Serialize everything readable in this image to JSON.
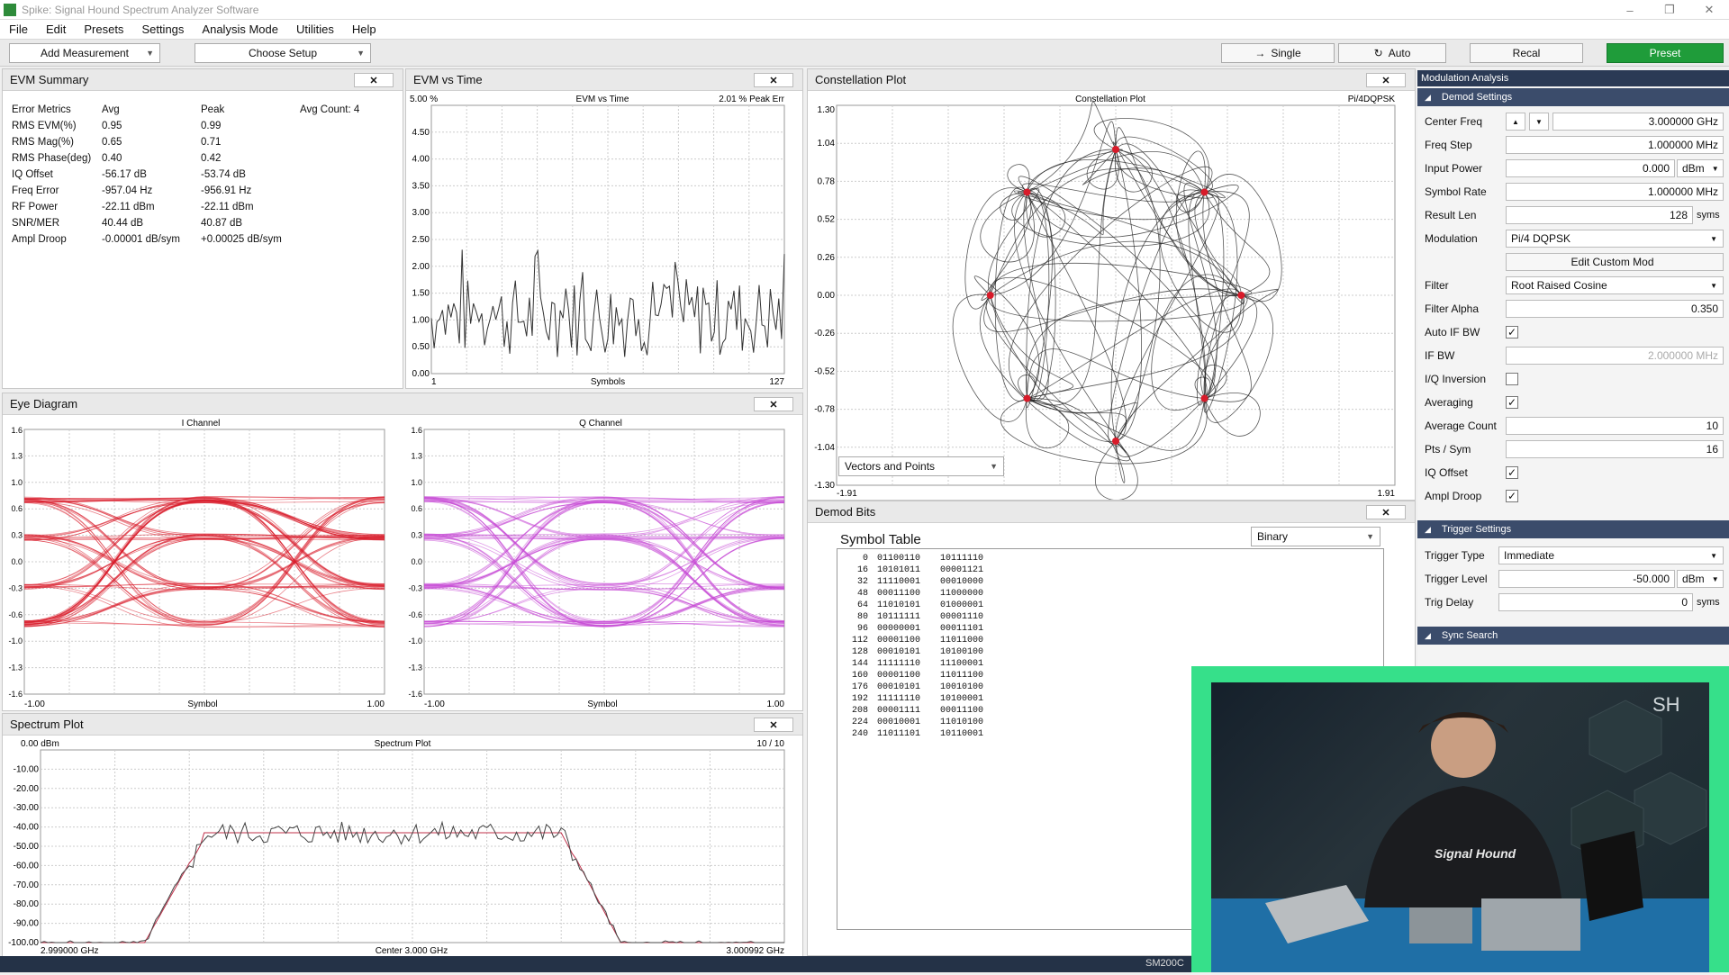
{
  "app": {
    "title": "Spike: Signal Hound Spectrum Analyzer Software"
  },
  "menu": [
    "File",
    "Edit",
    "Presets",
    "Settings",
    "Analysis Mode",
    "Utilities",
    "Help"
  ],
  "toolbar": {
    "add_measurement": "Add Measurement",
    "choose_setup": "Choose Setup",
    "single": "Single",
    "auto": "Auto",
    "recal": "Recal",
    "preset": "Preset"
  },
  "colors": {
    "accent": "#1f9c3a",
    "eye_i": "#d81b2a",
    "eye_q": "#c64ad6",
    "side_header": "#2b3a55",
    "trace": "#333333",
    "avg_trace": "#c0304a"
  },
  "evm_summary": {
    "title": "EVM Summary",
    "close": "✕",
    "headers": [
      "Error Metrics",
      "Avg",
      "Peak",
      "Avg Count: 4"
    ],
    "rows": [
      [
        "RMS EVM(%)",
        "0.95",
        "0.99"
      ],
      [
        "RMS Mag(%)",
        "0.65",
        "0.71"
      ],
      [
        "RMS Phase(deg)",
        "0.40",
        "0.42"
      ],
      [
        "IQ Offset",
        "-56.17 dB",
        "-53.74 dB"
      ],
      [
        "Freq Error",
        "-957.04 Hz",
        "-956.91 Hz"
      ],
      [
        "RF Power",
        "-22.11 dBm",
        "-22.11 dBm"
      ],
      [
        "SNR/MER",
        "40.44 dB",
        "40.87 dB"
      ],
      [
        "Ampl Droop",
        "-0.00001 dB/sym",
        "+0.00025 dB/sym"
      ]
    ]
  },
  "evm_time": {
    "title": "EVM vs Time",
    "close": "✕",
    "top_left": "5.00 %",
    "center": "EVM vs Time",
    "top_right": "2.01 % Peak Err",
    "yticks": [
      "4.50",
      "4.00",
      "3.50",
      "3.00",
      "2.50",
      "2.00",
      "1.50",
      "1.00",
      "0.50",
      "0.00"
    ],
    "x_start": "1",
    "x_label": "Symbols",
    "x_end": "127"
  },
  "constellation": {
    "title": "Constellation Plot",
    "close": "✕",
    "center": "Constellation Plot",
    "mod": "Pi/4DQPSK",
    "yticks": [
      "1.30",
      "1.04",
      "0.78",
      "0.52",
      "0.26",
      "0.00",
      "-0.26",
      "-0.52",
      "-0.78",
      "-1.04",
      "-1.30"
    ],
    "x_start": "-1.91",
    "x_end": "1.91",
    "view": "Vectors and Points"
  },
  "eye": {
    "title": "Eye Diagram",
    "close": "✕",
    "i_label": "I Channel",
    "q_label": "Q Channel",
    "yticks": [
      "1.6",
      "1.3",
      "1.0",
      "0.6",
      "0.3",
      "0.0",
      "-0.3",
      "-0.6",
      "-1.0",
      "-1.3",
      "-1.6"
    ],
    "x_start": "-1.00",
    "x_label": "Symbol",
    "x_end": "1.00"
  },
  "spectrum": {
    "title": "Spectrum Plot",
    "close": "✕",
    "top_left": "0.00 dBm",
    "center": "Spectrum Plot",
    "top_right": "10 / 10",
    "yticks": [
      "-10.00",
      "-20.00",
      "-30.00",
      "-40.00",
      "-50.00",
      "-60.00",
      "-70.00",
      "-80.00",
      "-90.00",
      "-100.00"
    ],
    "x_start": "2.999000 GHz",
    "x_center": "Center 3.000 GHz",
    "x_end": "3.000992 GHz"
  },
  "demod_bits": {
    "title": "Demod Bits",
    "close": "✕",
    "table_title": "Symbol Table",
    "format": "Binary",
    "rows": [
      [
        "0",
        "01100110",
        "10111110"
      ],
      [
        "16",
        "10101011",
        "00001121"
      ],
      [
        "32",
        "11110001",
        "00010000"
      ],
      [
        "48",
        "00011100",
        "11000000"
      ],
      [
        "64",
        "11010101",
        "01000001"
      ],
      [
        "80",
        "10111111",
        "00001110"
      ],
      [
        "96",
        "00000001",
        "00011101"
      ],
      [
        "112",
        "00001100",
        "11011000"
      ],
      [
        "128",
        "00010101",
        "10100100"
      ],
      [
        "144",
        "11111110",
        "11100001"
      ],
      [
        "160",
        "00001100",
        "11011100"
      ],
      [
        "176",
        "00010101",
        "10010100"
      ],
      [
        "192",
        "11111110",
        "10100001"
      ],
      [
        "208",
        "00001111",
        "00011100"
      ],
      [
        "224",
        "00010001",
        "11010100"
      ],
      [
        "240",
        "11011101",
        "10110001"
      ]
    ]
  },
  "sidebar": {
    "header": "Modulation Analysis",
    "demod_section": "Demod Settings",
    "trigger_section": "Trigger Settings",
    "sync_section": "Sync Search",
    "center_freq": {
      "label": "Center Freq",
      "value": "3.000000 GHz"
    },
    "freq_step": {
      "label": "Freq Step",
      "value": "1.000000 MHz"
    },
    "input_power": {
      "label": "Input Power",
      "value": "0.000",
      "unit": "dBm"
    },
    "symbol_rate": {
      "label": "Symbol Rate",
      "value": "1.000000 MHz"
    },
    "result_len": {
      "label": "Result Len",
      "value": "128",
      "unit": "syms"
    },
    "modulation": {
      "label": "Modulation",
      "value": "Pi/4 DQPSK"
    },
    "edit_custom": "Edit Custom Mod",
    "filter": {
      "label": "Filter",
      "value": "Root Raised Cosine"
    },
    "filter_alpha": {
      "label": "Filter Alpha",
      "value": "0.350"
    },
    "auto_if_bw": {
      "label": "Auto IF BW",
      "checked": "✓"
    },
    "if_bw": {
      "label": "IF BW",
      "value": "2.000000 MHz"
    },
    "iq_inversion": {
      "label": "I/Q Inversion",
      "checked": ""
    },
    "averaging": {
      "label": "Averaging",
      "checked": "✓"
    },
    "average_count": {
      "label": "Average Count",
      "value": "10"
    },
    "pts_sym": {
      "label": "Pts / Sym",
      "value": "16"
    },
    "iq_offset": {
      "label": "IQ Offset",
      "checked": "✓"
    },
    "ampl_droop": {
      "label": "Ampl Droop",
      "checked": "✓"
    },
    "trigger_type": {
      "label": "Trigger Type",
      "value": "Immediate"
    },
    "trigger_level": {
      "label": "Trigger Level",
      "value": "-50.000",
      "unit": "dBm"
    },
    "trig_delay": {
      "label": "Trig Delay",
      "value": "0",
      "unit": "syms"
    }
  },
  "status": {
    "device": "SM200C"
  },
  "video": {
    "brand": "Signal Hound",
    "logo": "SH"
  }
}
